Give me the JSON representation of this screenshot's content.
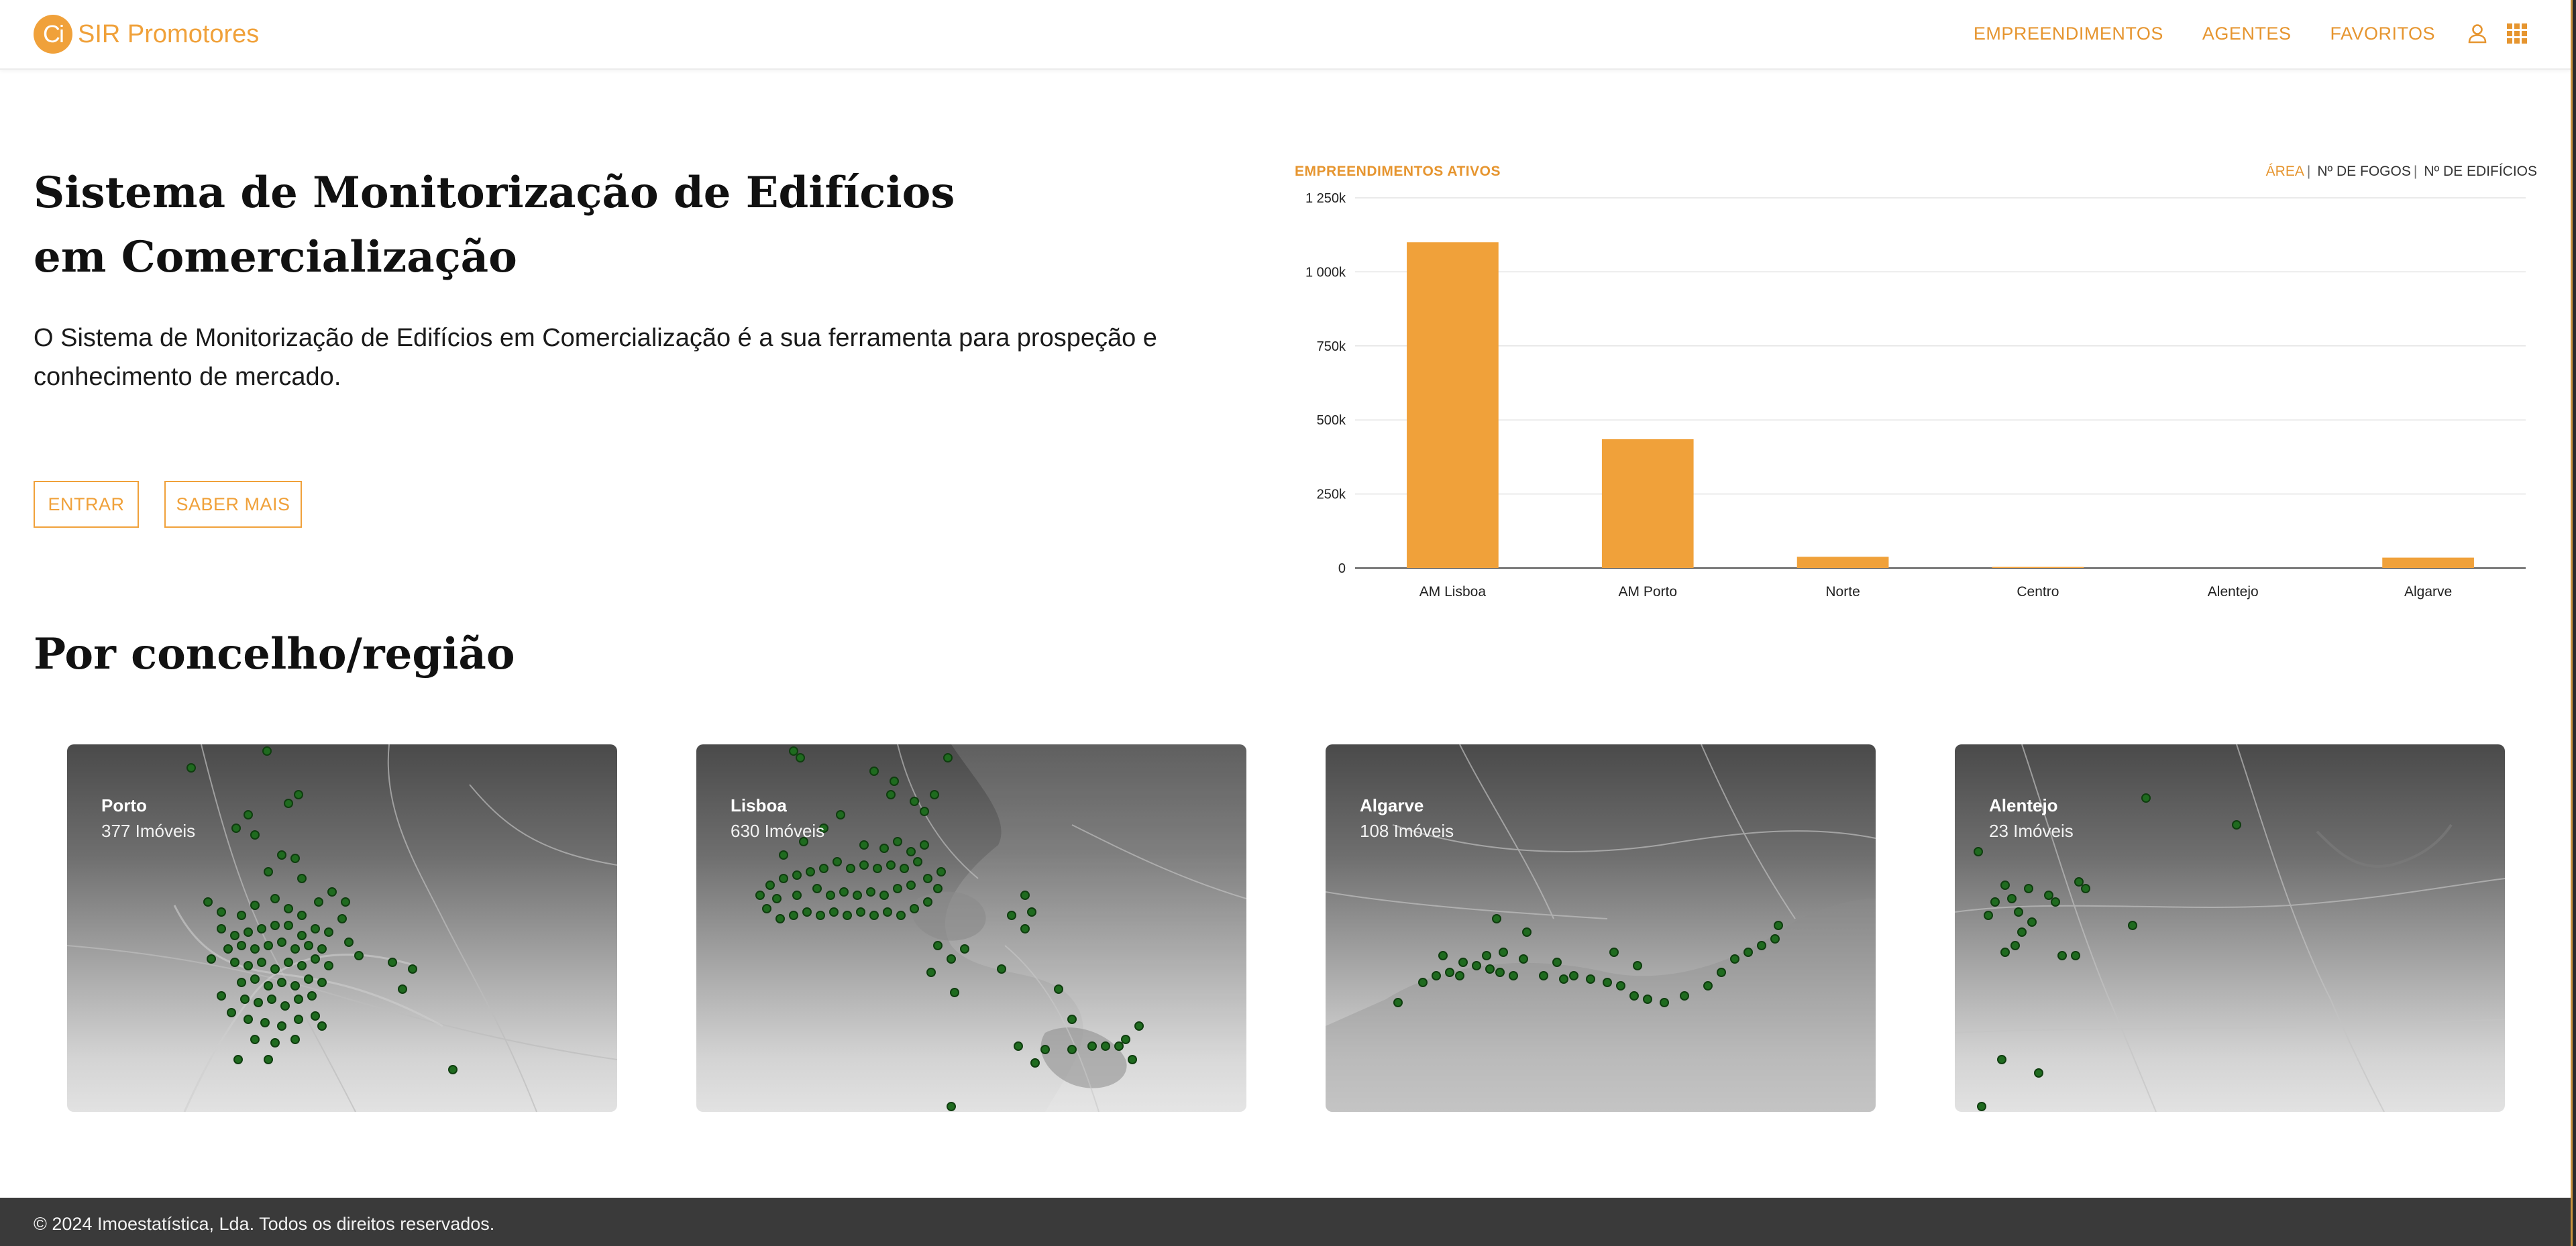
{
  "brand": {
    "mark": "Ci",
    "name": "SIR Promotores",
    "color": "#f0a13a"
  },
  "nav": {
    "items": [
      "EMPREENDIMENTOS",
      "AGENTES",
      "FAVORITOS"
    ],
    "user_icon": "user-icon",
    "apps_icon": "grid-apps-icon"
  },
  "hero": {
    "title": "Sistema de Monitorização de Edifícios em Comercialização",
    "description": "O Sistema de Monitorização de Edifícios em Comercialização é a sua ferramenta para prospeção e conhecimento de mercado.",
    "enter_label": "ENTRAR",
    "more_label": "SABER MAIS"
  },
  "chart_toggle": {
    "options": [
      "ÁREA",
      "Nº DE FOGOS",
      "Nº DE EDIFÍCIOS"
    ],
    "active": "ÁREA"
  },
  "chart_data": {
    "type": "bar",
    "title": "EMPREENDIMENTOS ATIVOS",
    "categories": [
      "AM Lisboa",
      "AM Porto",
      "Norte",
      "Centro",
      "Alentejo",
      "Algarve"
    ],
    "values": [
      1100000,
      435000,
      38000,
      4000,
      0,
      35000
    ],
    "ylim": [
      0,
      1250000
    ],
    "yticks": [
      0,
      250000,
      500000,
      750000,
      1000000,
      1250000
    ],
    "ytick_labels": [
      "0",
      "250k",
      "500k",
      "750k",
      "1 000k",
      "1 250k"
    ],
    "bar_color": "#f0a13a",
    "grid": true,
    "xlabel": "",
    "ylabel": ""
  },
  "regions_section": {
    "title": "Por concelho/região",
    "cards": [
      {
        "name": "Porto",
        "count": "377 Imóveis"
      },
      {
        "name": "Lisboa",
        "count": "630 Imóveis"
      },
      {
        "name": "Algarve",
        "count": "108 Imóveis"
      },
      {
        "name": "Alentejo",
        "count": "23 Imóveis"
      }
    ]
  },
  "footer": {
    "text": "© 2024 Imoestatística, Lda. Todos os direitos reservados."
  }
}
